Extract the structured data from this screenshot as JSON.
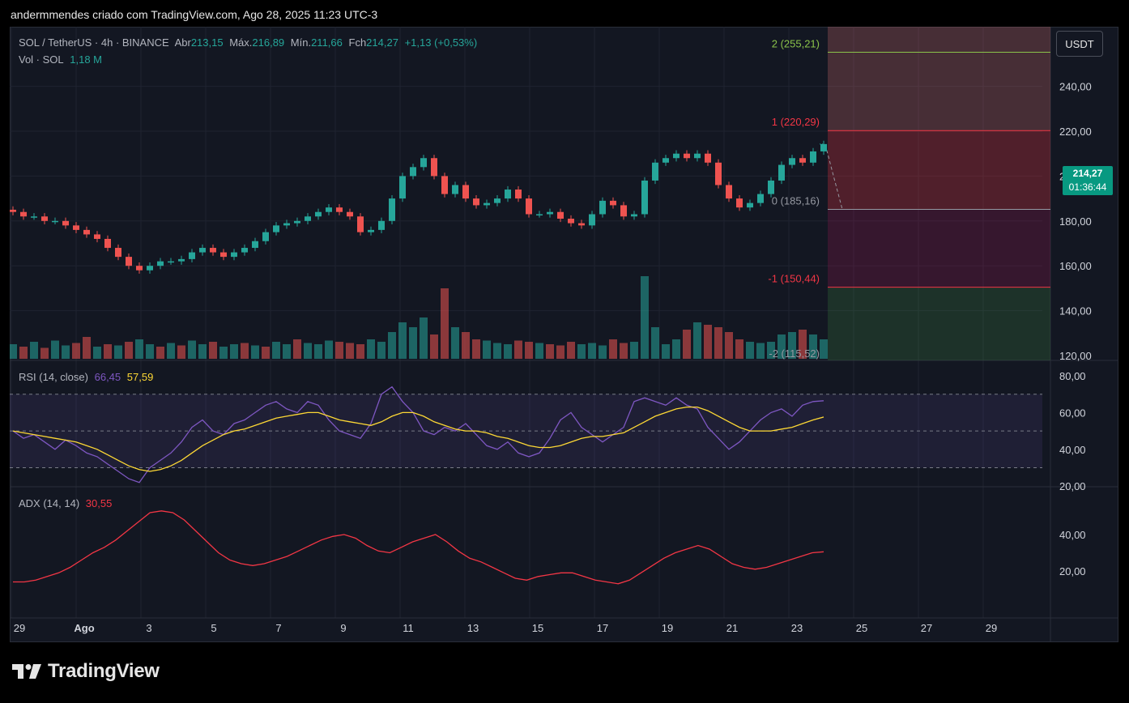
{
  "caption": "andermmendes criado com TradingView.com, Ago 28, 2025 11:23 UTC-3",
  "brand": "TradingView",
  "colors": {
    "up": "#26a69a",
    "down": "#ef5350",
    "rsi": "#7e57c2",
    "rsi_ma": "#fdd835",
    "adx": "#f23645",
    "bg": "#131722"
  },
  "legend": {
    "symbol": "SOL / TetherUS · 4h · BINANCE",
    "open_label": "Abr",
    "open": "213,15",
    "high_label": "Máx.",
    "high": "216,89",
    "low_label": "Mín.",
    "low": "211,66",
    "close_label": "Fch",
    "close": "214,27",
    "change": "+1,13 (+0,53%)",
    "vol_label": "Vol · SOL",
    "vol": "1,18 M"
  },
  "currency": "USDT",
  "current_price": {
    "price": "214,27",
    "countdown": "01:36:44",
    "value": 214.27
  },
  "fib_levels": [
    {
      "label": "2 (255,21)",
      "value": 255.21,
      "color": "#8bc34a"
    },
    {
      "label": "1 (220,29)",
      "value": 220.29,
      "color": "#f23645"
    },
    {
      "label": "0 (185,16)",
      "value": 185.16,
      "color": "#9598a1"
    },
    {
      "label": "-1 (150,44)",
      "value": 150.44,
      "color": "#f23645"
    },
    {
      "label": "-2 (115,52)",
      "value": 115.52,
      "color": "#9598a1"
    }
  ],
  "price_axis": [
    "240,00",
    "220,00",
    "200,00",
    "180,00",
    "160,00",
    "140,00",
    "120,00"
  ],
  "rsi_axis": [
    "80,00",
    "60,00",
    "40,00",
    "20,00"
  ],
  "adx_axis": [
    "40,00",
    "20,00"
  ],
  "x_axis": [
    "29",
    "Ago",
    "3",
    "5",
    "7",
    "9",
    "11",
    "13",
    "15",
    "17",
    "19",
    "21",
    "23",
    "25",
    "27",
    "29"
  ],
  "rsi_legend": {
    "label": "RSI (14, close)",
    "rsi": "66,45",
    "ma": "57,59"
  },
  "adx_legend": {
    "label": "ADX (14, 14)",
    "value": "30,55"
  },
  "chart_data": [
    {
      "type": "candlestick",
      "title": "SOL / TetherUS · 4h · BINANCE",
      "x_ticks": [
        "29",
        "Ago",
        "3",
        "5",
        "7",
        "9",
        "11",
        "13",
        "15",
        "17",
        "19",
        "21",
        "23",
        "25",
        "27",
        "29"
      ],
      "ylim": [
        120,
        260
      ],
      "close_series": [
        [
          0,
          184
        ],
        [
          1,
          182
        ],
        [
          2,
          182
        ],
        [
          3,
          180
        ],
        [
          4,
          180
        ],
        [
          5,
          178
        ],
        [
          6,
          176
        ],
        [
          7,
          174
        ],
        [
          8,
          172
        ],
        [
          9,
          168
        ],
        [
          10,
          164
        ],
        [
          11,
          160
        ],
        [
          12,
          158
        ],
        [
          13,
          160
        ],
        [
          14,
          162
        ],
        [
          15,
          162
        ],
        [
          16,
          163
        ],
        [
          17,
          166
        ],
        [
          18,
          168
        ],
        [
          19,
          166
        ],
        [
          20,
          164
        ],
        [
          21,
          166
        ],
        [
          22,
          168
        ],
        [
          23,
          171
        ],
        [
          24,
          175
        ],
        [
          25,
          178
        ],
        [
          26,
          179
        ],
        [
          27,
          180
        ],
        [
          28,
          182
        ],
        [
          29,
          184
        ],
        [
          30,
          186
        ],
        [
          31,
          184
        ],
        [
          32,
          182
        ],
        [
          33,
          175
        ],
        [
          34,
          176
        ],
        [
          35,
          180
        ],
        [
          36,
          190
        ],
        [
          37,
          200
        ],
        [
          38,
          204
        ],
        [
          39,
          208
        ],
        [
          40,
          200
        ],
        [
          41,
          192
        ],
        [
          42,
          196
        ],
        [
          43,
          190
        ],
        [
          44,
          187
        ],
        [
          45,
          188
        ],
        [
          46,
          190
        ],
        [
          47,
          194
        ],
        [
          48,
          190
        ],
        [
          49,
          183
        ],
        [
          50,
          183
        ],
        [
          51,
          184
        ],
        [
          52,
          181
        ],
        [
          53,
          179
        ],
        [
          54,
          178
        ],
        [
          55,
          183
        ],
        [
          56,
          189
        ],
        [
          57,
          187
        ],
        [
          58,
          182
        ],
        [
          59,
          183
        ],
        [
          60,
          198
        ],
        [
          61,
          206
        ],
        [
          62,
          208
        ],
        [
          63,
          210
        ],
        [
          64,
          208
        ],
        [
          65,
          210
        ],
        [
          66,
          206
        ],
        [
          67,
          196
        ],
        [
          68,
          190
        ],
        [
          69,
          186
        ],
        [
          70,
          188
        ],
        [
          71,
          192
        ],
        [
          72,
          198
        ],
        [
          73,
          205
        ],
        [
          74,
          208
        ],
        [
          75,
          206
        ],
        [
          76,
          211
        ],
        [
          77,
          214.27
        ]
      ]
    },
    {
      "type": "bar",
      "title": "Vol · SOL",
      "values": [
        1.2,
        1.0,
        1.4,
        0.9,
        1.5,
        1.1,
        1.3,
        1.8,
        1.0,
        1.2,
        1.1,
        1.4,
        1.6,
        1.2,
        1.0,
        1.3,
        1.1,
        1.5,
        1.2,
        1.4,
        1.0,
        1.2,
        1.3,
        1.1,
        1.0,
        1.4,
        1.2,
        1.6,
        1.3,
        1.2,
        1.5,
        1.4,
        1.3,
        1.2,
        1.6,
        1.4,
        2.2,
        3.0,
        2.6,
        3.4,
        2.0,
        5.8,
        2.6,
        2.2,
        1.6,
        1.5,
        1.3,
        1.2,
        1.5,
        1.4,
        1.3,
        1.2,
        1.1,
        1.4,
        1.2,
        1.3,
        1.1,
        1.6,
        1.3,
        1.4,
        6.8,
        2.6,
        1.2,
        1.6,
        2.4,
        3.0,
        2.8,
        2.6,
        2.2,
        1.6,
        1.4,
        1.3,
        1.4,
        2.0,
        2.2,
        2.4,
        2.0,
        1.6
      ],
      "up": [
        true,
        false,
        true,
        false,
        true,
        true,
        false,
        false,
        true,
        false,
        true,
        false,
        true,
        true,
        false,
        true,
        false,
        true,
        true,
        false,
        true,
        true,
        false,
        true,
        false,
        true,
        true,
        false,
        true,
        true,
        true,
        false,
        false,
        false,
        true,
        true,
        true,
        true,
        true,
        true,
        false,
        false,
        true,
        false,
        false,
        true,
        true,
        true,
        false,
        false,
        true,
        false,
        false,
        false,
        true,
        true,
        true,
        false,
        false,
        true,
        true,
        true,
        true,
        true,
        false,
        true,
        false,
        false,
        false,
        false,
        true,
        true,
        true,
        true,
        true,
        false,
        true,
        true
      ]
    },
    {
      "type": "line",
      "title": "RSI (14, close)",
      "ylim": [
        20,
        80
      ],
      "series": [
        {
          "name": "RSI",
          "values": [
            50,
            46,
            48,
            44,
            40,
            45,
            42,
            38,
            36,
            32,
            28,
            24,
            22,
            30,
            34,
            38,
            44,
            52,
            56,
            50,
            48,
            54,
            56,
            60,
            64,
            66,
            62,
            60,
            66,
            64,
            56,
            50,
            48,
            46,
            54,
            70,
            74,
            66,
            60,
            50,
            48,
            52,
            50,
            54,
            48,
            42,
            40,
            44,
            38,
            36,
            38,
            46,
            56,
            60,
            52,
            48,
            44,
            48,
            52,
            66,
            68,
            66,
            64,
            68,
            64,
            62,
            52,
            46,
            40,
            44,
            50,
            56,
            60,
            62,
            58,
            64,
            66,
            66.45
          ]
        },
        {
          "name": "MA",
          "values": [
            50,
            49,
            48,
            47,
            46,
            45,
            44,
            42,
            40,
            37,
            34,
            31,
            29,
            28,
            29,
            31,
            34,
            38,
            42,
            45,
            48,
            50,
            51,
            53,
            55,
            57,
            58,
            59,
            60,
            60,
            58,
            56,
            55,
            54,
            53,
            55,
            58,
            60,
            60,
            58,
            55,
            53,
            51,
            50,
            50,
            49,
            47,
            46,
            44,
            42,
            41,
            41,
            42,
            44,
            46,
            47,
            47,
            48,
            49,
            52,
            55,
            58,
            60,
            62,
            63,
            63,
            61,
            58,
            55,
            52,
            50,
            50,
            50,
            51,
            52,
            54,
            56,
            57.59
          ]
        }
      ]
    },
    {
      "type": "line",
      "title": "ADX (14, 14)",
      "series": [
        {
          "name": "ADX",
          "values": [
            14,
            14,
            15,
            17,
            19,
            22,
            26,
            30,
            33,
            37,
            42,
            47,
            52,
            53,
            52,
            48,
            42,
            36,
            30,
            26,
            24,
            23,
            24,
            26,
            28,
            31,
            34,
            37,
            39,
            40,
            38,
            34,
            31,
            30,
            33,
            36,
            38,
            40,
            36,
            31,
            27,
            25,
            22,
            19,
            16,
            15,
            17,
            18,
            19,
            19,
            17,
            15,
            14,
            13,
            15,
            19,
            23,
            27,
            30,
            32,
            34,
            32,
            28,
            24,
            22,
            21,
            22,
            24,
            26,
            28,
            30,
            30.55
          ]
        }
      ]
    }
  ]
}
